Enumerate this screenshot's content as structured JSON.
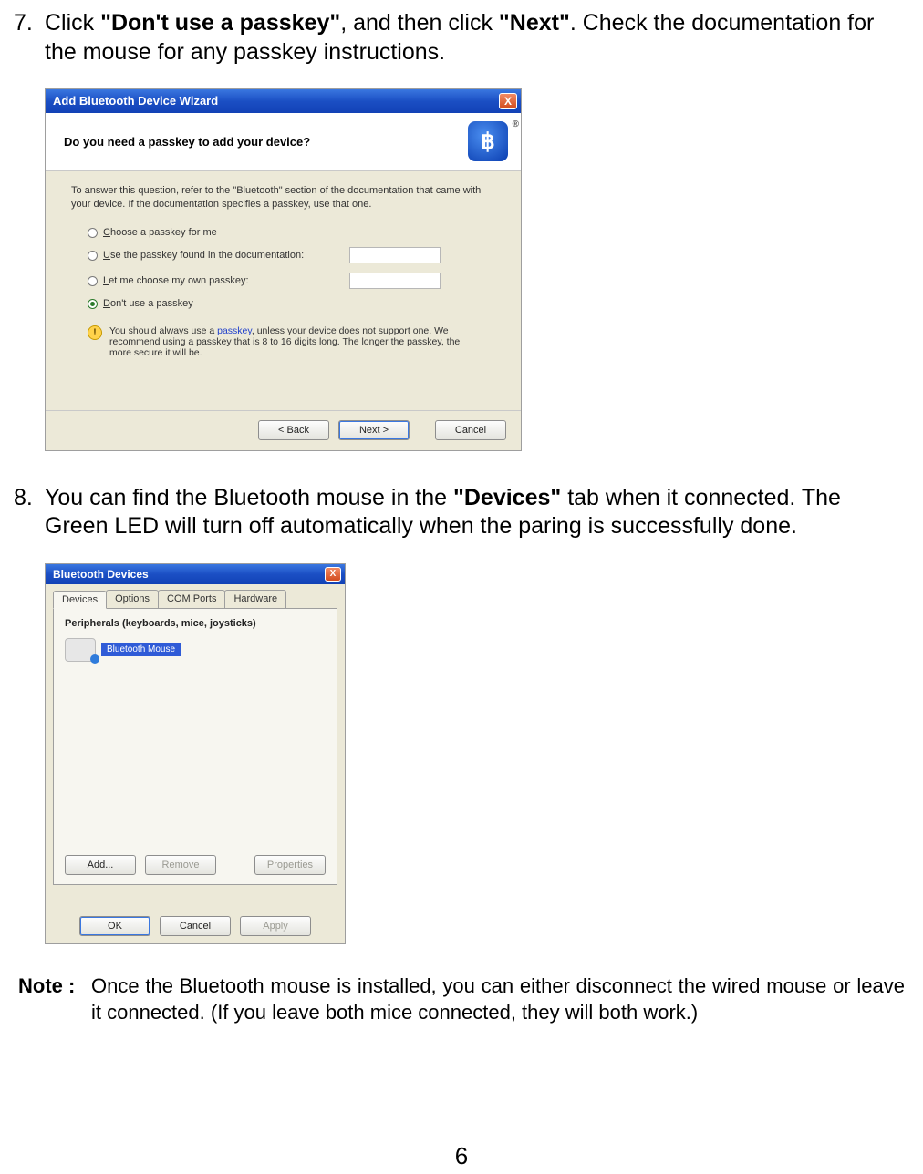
{
  "step7": {
    "num": "7.",
    "pre": " Click ",
    "bold1": "\"Don't use a passkey\"",
    "mid": ", and then click ",
    "bold2": "\"Next\"",
    "post": ". Check the documentation for the mouse for any passkey instructions."
  },
  "dlg1": {
    "title": "Add Bluetooth Device Wizard",
    "close": "X",
    "heading": "Do you need a passkey to add your device?",
    "bt_glyph": "฿",
    "instr": "To answer this question, refer to the \"Bluetooth\" section of the documentation that came with your device. If the documentation specifies a passkey, use that one.",
    "opt1_u": "C",
    "opt1": "hoose a passkey for me",
    "opt2_u": "U",
    "opt2": "se the passkey found in the documentation:",
    "opt3_u": "L",
    "opt3": "et me choose my own passkey:",
    "opt4_u": "D",
    "opt4": "on't use a passkey",
    "info_pre": "You should always use a ",
    "info_link": "passkey",
    "info_post": ", unless your device does not support one. We recommend using a passkey that is 8 to 16 digits long. The longer the passkey, the more secure it will be.",
    "back": "< Back",
    "next": "Next >",
    "cancel": "Cancel",
    "info_icon": "!"
  },
  "step8": {
    "num": "8.",
    "pre": " You can find the Bluetooth mouse in the ",
    "bold1": "\"Devices\"",
    "post": " tab when it connected. The Green LED will turn off automatically when the paring is successfully done."
  },
  "dlg2": {
    "title": "Bluetooth Devices",
    "close": "X",
    "tabs": [
      "Devices",
      "Options",
      "COM Ports",
      "Hardware"
    ],
    "category": "Peripherals (keyboards, mice, joysticks)",
    "device": "Bluetooth Mouse",
    "add": "Add...",
    "remove": "Remove",
    "properties": "Properties",
    "ok": "OK",
    "cancel": "Cancel",
    "apply": "Apply"
  },
  "note": {
    "label": "Note :",
    "text": " Once the Bluetooth mouse is installed, you can either disconnect the wired mouse or leave it connected. (If you leave both mice connected, they will both work.)"
  },
  "page_number": "6"
}
